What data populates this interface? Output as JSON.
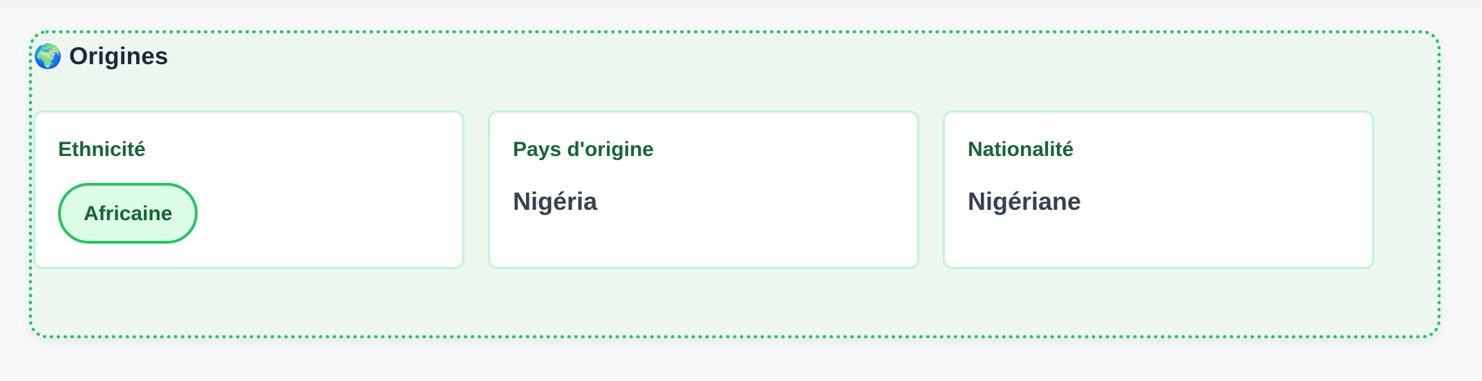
{
  "section": {
    "icon": "globe-africa-icon",
    "title": "Origines"
  },
  "cards": [
    {
      "label": "Ethnicité",
      "value": "Africaine",
      "style": "pill"
    },
    {
      "label": "Pays d'origine",
      "value": "Nigéria",
      "style": "text"
    },
    {
      "label": "Nationalité",
      "value": "Nigériane",
      "style": "text"
    }
  ],
  "colors": {
    "accent_green": "#22c55e",
    "label_green": "#166534",
    "card_border": "#bbf7d0",
    "section_bg": "#eef6f0",
    "pill_bg": "#dcfce7"
  }
}
